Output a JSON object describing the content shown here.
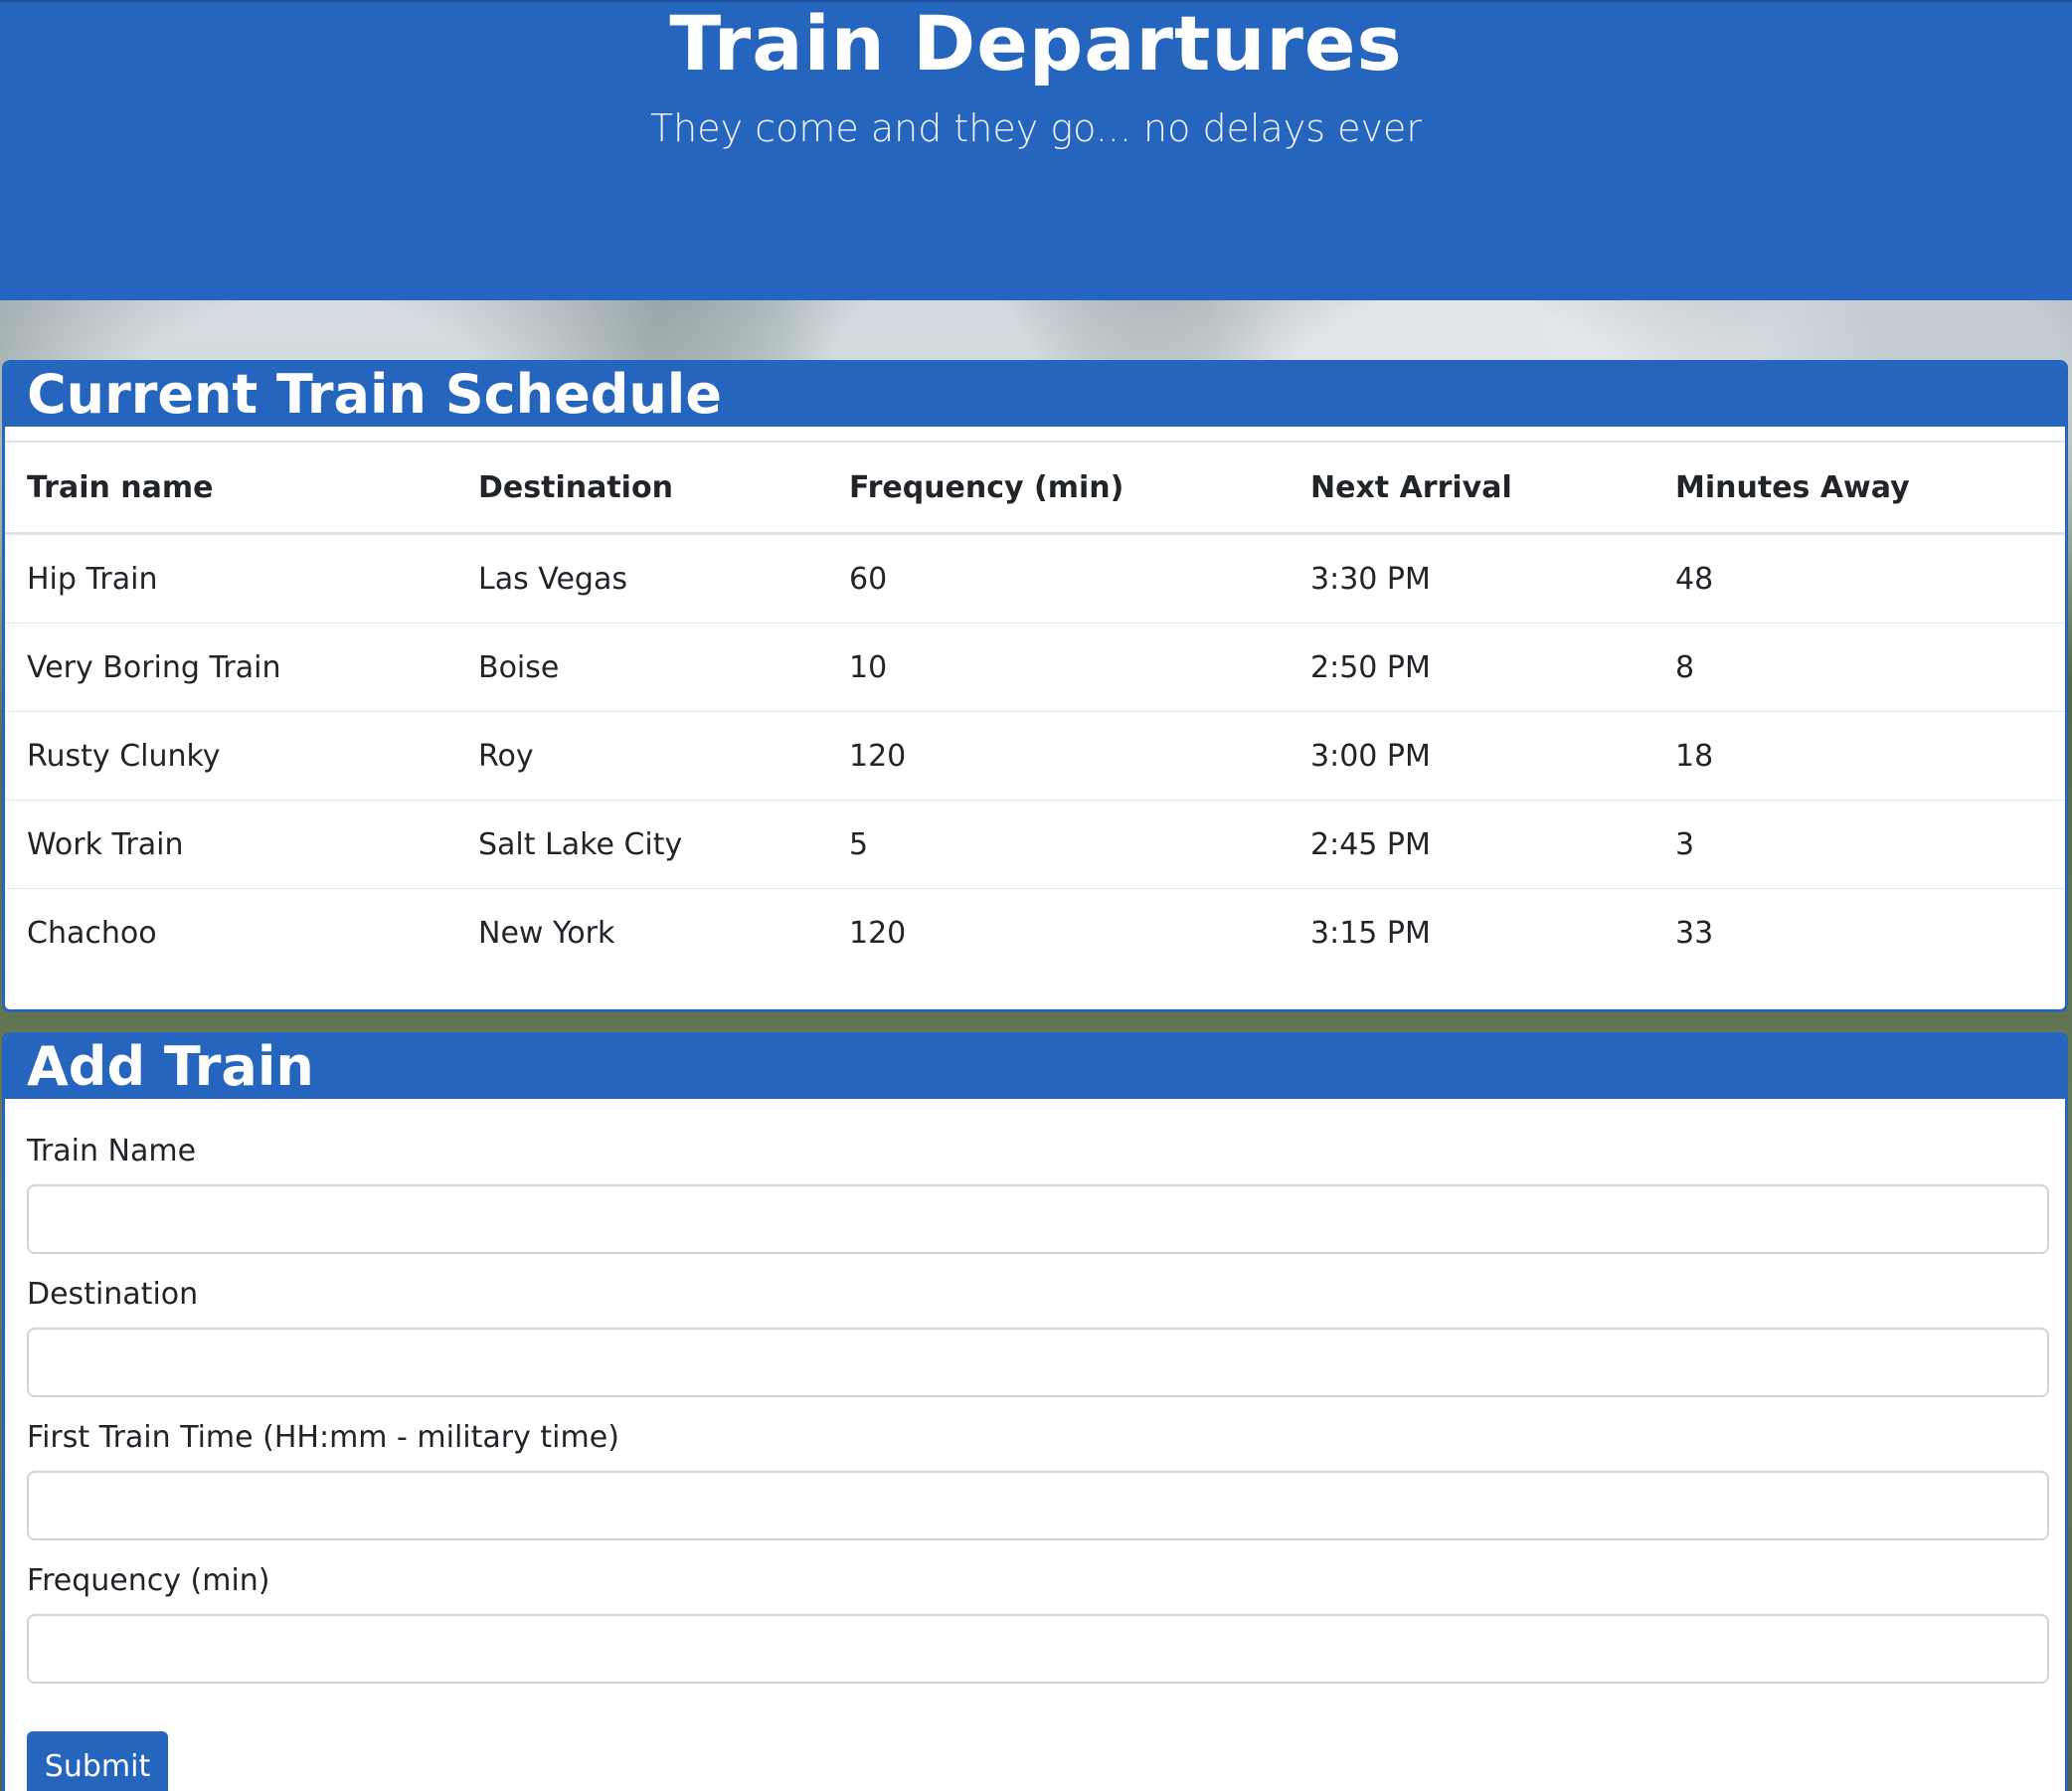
{
  "header": {
    "title": "Train Departures",
    "subtitle": "They come and they go... no delays ever"
  },
  "schedule": {
    "title": "Current Train Schedule",
    "columns": [
      "Train name",
      "Destination",
      "Frequency (min)",
      "Next Arrival",
      "Minutes Away"
    ],
    "rows": [
      [
        "Hip Train",
        "Las Vegas",
        "60",
        "3:30 PM",
        "48"
      ],
      [
        "Very Boring Train",
        "Boise",
        "10",
        "2:50 PM",
        "8"
      ],
      [
        "Rusty Clunky",
        "Roy",
        "120",
        "3:00 PM",
        "18"
      ],
      [
        "Work Train",
        "Salt Lake City",
        "5",
        "2:45 PM",
        "3"
      ],
      [
        "Chachoo",
        "New York",
        "120",
        "3:15 PM",
        "33"
      ]
    ]
  },
  "form": {
    "title": "Add Train",
    "fields": [
      {
        "label": "Train Name",
        "value": "",
        "placeholder": ""
      },
      {
        "label": "Destination",
        "value": "",
        "placeholder": ""
      },
      {
        "label": "First Train Time (HH:mm - military time)",
        "value": "",
        "placeholder": ""
      },
      {
        "label": "Frequency (min)",
        "value": "",
        "placeholder": ""
      }
    ],
    "submit_label": "Submit"
  },
  "colors": {
    "primary": "#2565bd",
    "text": "#212529",
    "border": "#dee2e6"
  }
}
